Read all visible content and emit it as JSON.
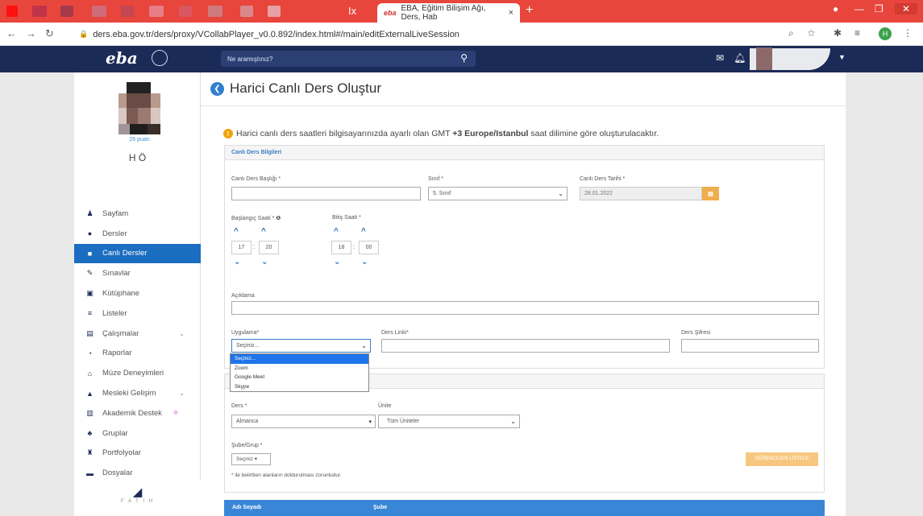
{
  "browser": {
    "tab_title": "EBA, Eğitim Bilişim Ağı, Ders, Hab",
    "tab_close": "×",
    "new_tab": "+",
    "url": "ders.eba.gov.tr/ders/proxy/VCollabPlayer_v0.0.892/index.html#/main/editExternalLiveSession",
    "profile_initial": "H",
    "accent": "#e8453c"
  },
  "topnav": {
    "logo": "eba",
    "search_placeholder": "Ne aramıştınız?"
  },
  "profile": {
    "points": "26 puan",
    "name": "H     Ö"
  },
  "sidebar": {
    "items": [
      {
        "label": "Sayfam",
        "icon": "person-icon"
      },
      {
        "label": "Dersler",
        "icon": "circle-icon"
      },
      {
        "label": "Canlı Dersler",
        "icon": "video-icon",
        "active": true
      },
      {
        "label": "Sınavlar",
        "icon": "pencil-icon"
      },
      {
        "label": "Kütüphane",
        "icon": "book-icon"
      },
      {
        "label": "Listeler",
        "icon": "list-icon"
      },
      {
        "label": "Çalışmalar",
        "icon": "works-icon",
        "chevron": true
      },
      {
        "label": "Raporlar",
        "icon": "chart-icon"
      },
      {
        "label": "Müze Deneyimleri",
        "icon": "museum-icon"
      },
      {
        "label": "Mesleki Gelişim",
        "icon": "graduation-icon",
        "chevron": true
      },
      {
        "label": "Akademik Destek",
        "icon": "bars-icon"
      },
      {
        "label": "Gruplar",
        "icon": "group-icon"
      },
      {
        "label": "Portfolyolar",
        "icon": "portfolio-icon"
      },
      {
        "label": "Dosyalar",
        "icon": "folder-icon"
      }
    ],
    "footer": "F A T İ H"
  },
  "page": {
    "title": "Harici Canlı Ders Oluştur",
    "info_prefix": "Harici canlı ders saatleri bilgisayarınızda ayarlı olan GMT ",
    "info_bold": "+3 Europe/Istanbul",
    "info_suffix": " saat dilimine göre oluşturulacaktır."
  },
  "form": {
    "section_title": "Canlı Ders Bilgileri",
    "title_label": "Canlı Ders Başlığı *",
    "title_value": "",
    "class_label": "Sınıf *",
    "class_value": "5. Sınıf",
    "date_label": "Canlı Ders Tarihi *",
    "date_value": "28.01.2022",
    "start_label": "Başlangıç Saati *",
    "start_hour": "17",
    "start_min": "20",
    "end_label": "Bitiş Saati *",
    "end_hour": "18",
    "end_min": "00",
    "desc_label": "Açıklama",
    "desc_value": "",
    "app_label": "Uygulama*",
    "app_value": "Seçiniz...",
    "app_options": [
      "Seçiniz...",
      "Zoom",
      "Google Meet",
      "Skype"
    ],
    "link_label": "Ders Linki*",
    "pass_label": "Ders Şifresi"
  },
  "students": {
    "lesson_label": "Ders *",
    "lesson_value": "Almanca",
    "unit_label": "Ünite",
    "unit_value": "Tüm Üniteler",
    "group_label": "Şube/Grup *",
    "group_value": "Seçiniz",
    "list_button": "ÖĞRENCİLERİ LİSTELE",
    "required_note": "* ile belirtilen alanların doldurulması zorunludur.",
    "col_name": "Adı Soyadı",
    "col_branch": "Şube"
  }
}
